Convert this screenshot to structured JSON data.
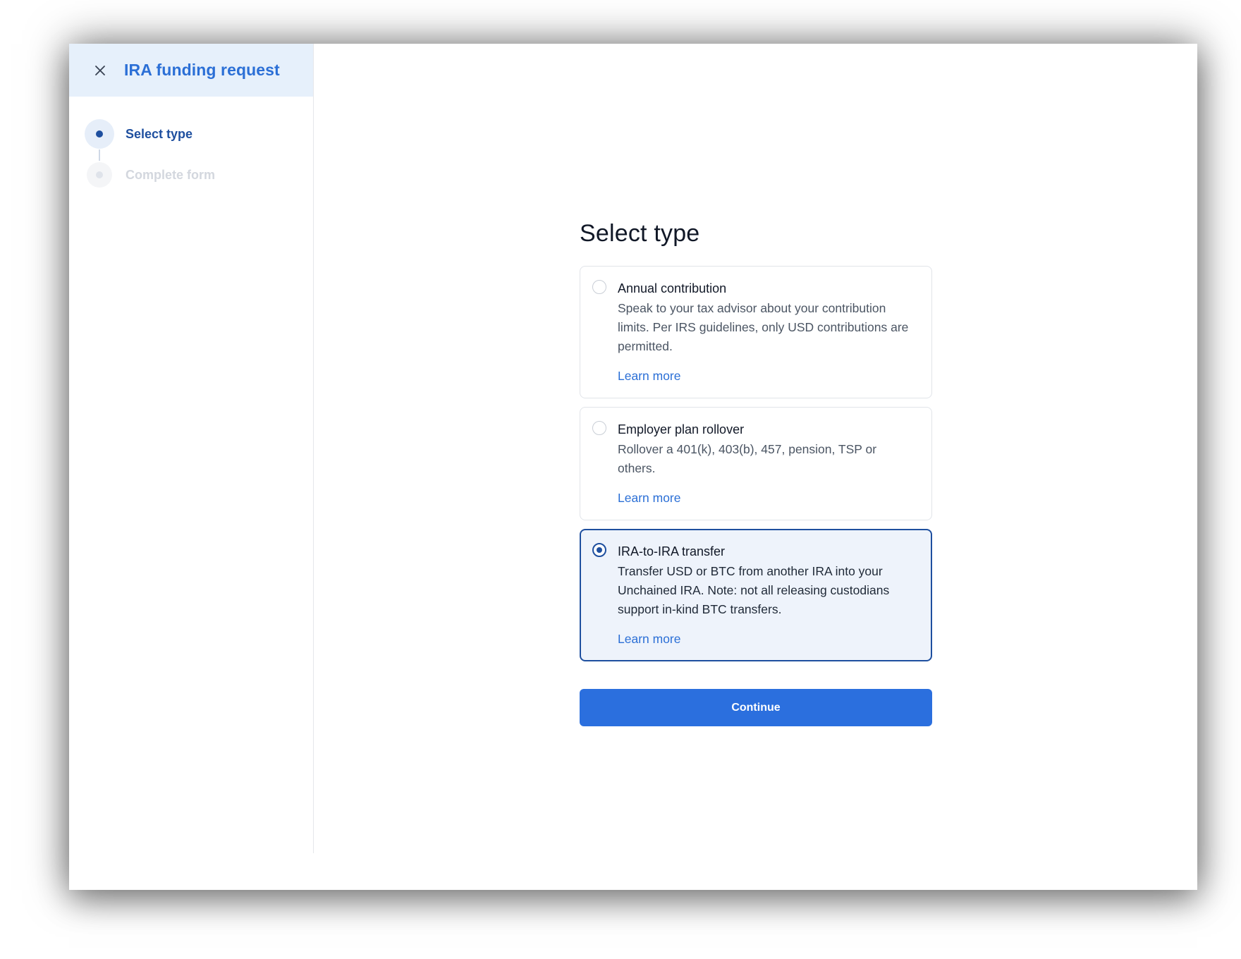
{
  "sidebar": {
    "title": "IRA funding request",
    "close_icon": "close-icon",
    "steps": [
      {
        "label": "Select type",
        "state": "active"
      },
      {
        "label": "Complete form",
        "state": "inactive"
      }
    ]
  },
  "main": {
    "title": "Select type",
    "options": [
      {
        "title": "Annual contribution",
        "description": "Speak to your tax advisor about your contribution limits. Per IRS guidelines, only USD contributions are permitted.",
        "link": "Learn more",
        "selected": false
      },
      {
        "title": "Employer plan rollover",
        "description": "Rollover a 401(k), 403(b), 457, pension, TSP or others.",
        "link": "Learn more",
        "selected": false
      },
      {
        "title": "IRA-to-IRA transfer",
        "description": "Transfer USD or BTC from another IRA into your Unchained IRA. Note: not all releasing custodians support in-kind BTC transfers.",
        "link": "Learn more",
        "selected": true
      }
    ],
    "continue_label": "Continue"
  },
  "colors": {
    "accent": "#2b6fde",
    "selected_border": "#1e4f9f",
    "selected_bg": "#eef3fb",
    "header_bg": "#e6f0fb"
  }
}
